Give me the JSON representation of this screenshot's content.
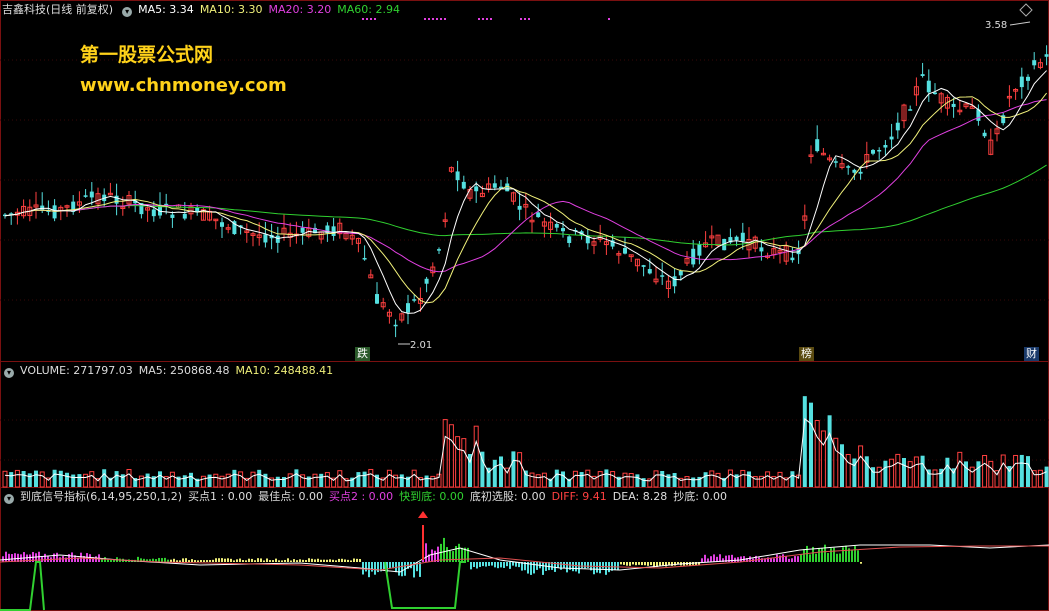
{
  "price_header": {
    "stock_name": "吉鑫科技",
    "period": "(日线 前复权)",
    "ma5": "MA5: 3.34",
    "ma10": "MA10: 3.30",
    "ma20": "MA20: 3.20",
    "ma60": "MA60: 2.94"
  },
  "watermark": {
    "line1": "第一股票公式网",
    "line2": "www.chnmoney.com"
  },
  "annotations": {
    "high": "3.58",
    "low": "2.01"
  },
  "markers": [
    "跌",
    "榜",
    "财"
  ],
  "volume_header": {
    "volume": "VOLUME: 271797.03",
    "ma5": "MA5: 250868.48",
    "ma10": "MA10: 248488.41"
  },
  "indicator_header": {
    "name": "到底信号指标(6,14,95,250,1,2)",
    "buy1": "买点1 : 0.00",
    "best": "最佳点: 0.00",
    "buy2": "买点2 : 0.00",
    "fast_bottom": "快到底: 0.00",
    "initial": "底初选股: 0.00",
    "diff": "DIFF: 9.41",
    "dea": "DEA: 8.28",
    "bottom": "抄底: 0.00"
  },
  "colors": {
    "ma5": "#ffffff",
    "ma10": "#f0f07a",
    "ma20": "#e040e0",
    "ma60": "#30d030",
    "up": "#ff4040",
    "down": "#55e0e0",
    "grid": "#7a1010"
  }
}
